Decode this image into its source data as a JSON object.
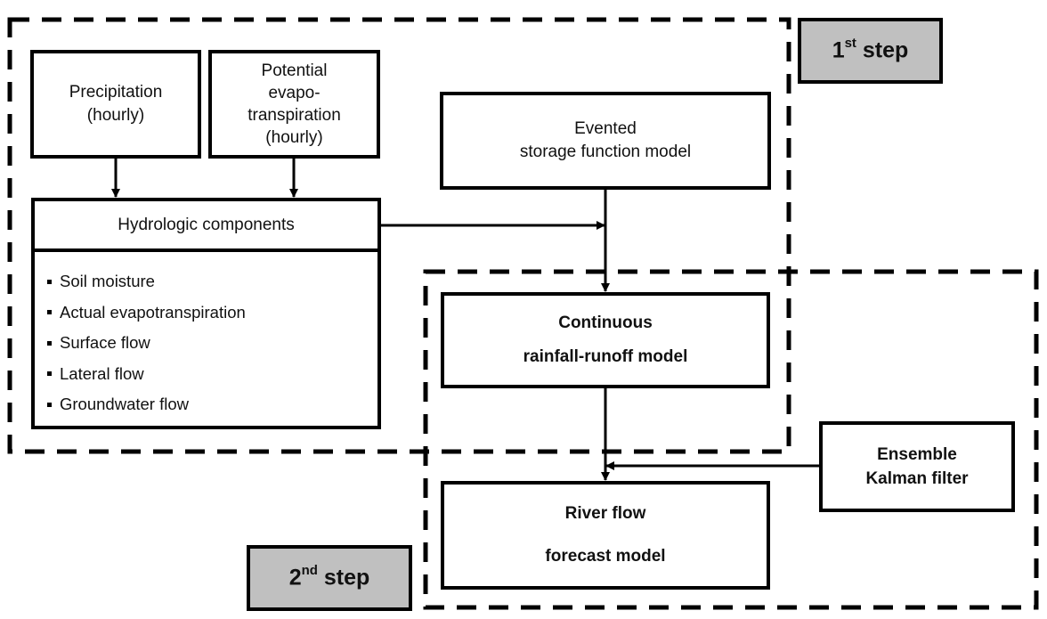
{
  "diagram": {
    "steps": {
      "first": {
        "number": "1",
        "suffix": "st",
        "word": "step"
      },
      "second": {
        "number": "2",
        "suffix": "nd",
        "word": "step"
      }
    },
    "boxes": {
      "precipitation": {
        "line1": "Precipitation",
        "line2": "(hourly)"
      },
      "pet": {
        "line1": "Potential",
        "line2": "evapo-",
        "line3": "transpiration",
        "line4": "(hourly)"
      },
      "evented": {
        "line1": "Evented",
        "line2": "storage function model"
      },
      "hydrologic": {
        "title": "Hydrologic components",
        "items": [
          "Soil moisture",
          "Actual evapotranspiration",
          "Surface flow",
          "Lateral flow",
          "Groundwater flow"
        ]
      },
      "continuous": {
        "line1": "Continuous",
        "line2": "rainfall-runoff model"
      },
      "enkf": {
        "line1": "Ensemble",
        "line2": "Kalman filter"
      },
      "river": {
        "line1": "River flow",
        "line2": "forecast model"
      }
    },
    "colors": {
      "step_fill": "#c0c0c0",
      "stroke": "#000000"
    }
  }
}
